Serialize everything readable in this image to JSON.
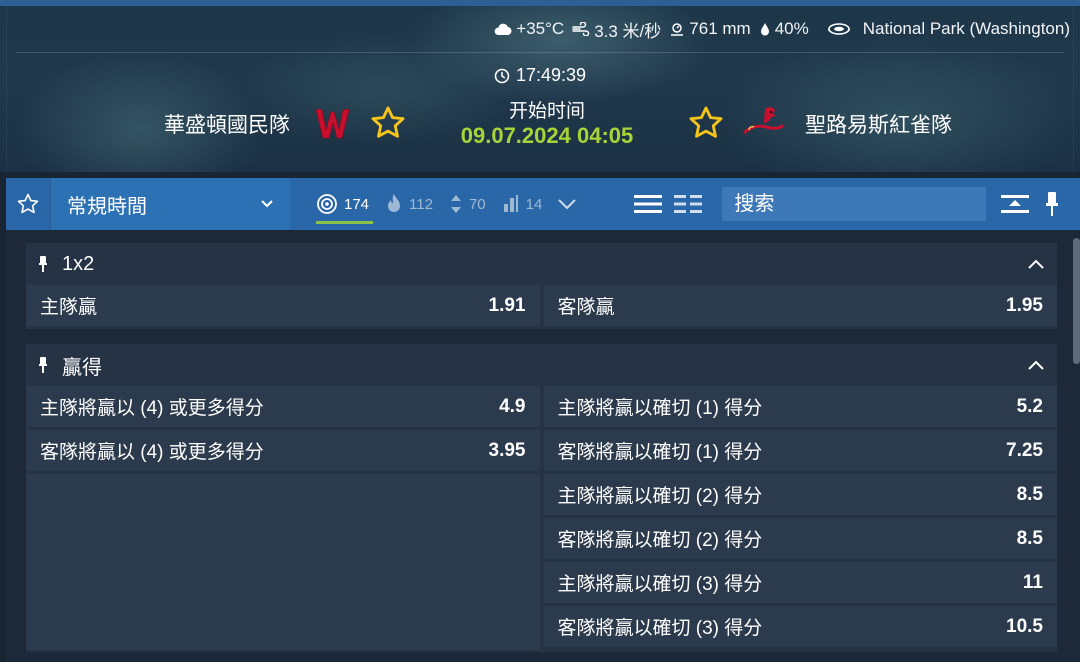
{
  "weather": {
    "temperature": "+35°C",
    "wind": "3.3 米/秒",
    "pressure": "761 mm",
    "humidity": "40%",
    "venue": "National Park (Washington)"
  },
  "event": {
    "clock": "17:49:39",
    "start_label": "开始时间",
    "start_datetime": "09.07.2024 04:05",
    "home_team": "華盛頓國民隊",
    "away_team": "聖路易斯紅雀隊"
  },
  "toolbar": {
    "period": "常規時間",
    "stats": [
      {
        "icon": "target-icon",
        "count": "174"
      },
      {
        "icon": "fire-icon",
        "count": "112"
      },
      {
        "icon": "updown-arrows-icon",
        "count": "70"
      },
      {
        "icon": "bar-chart-icon",
        "count": "14"
      }
    ],
    "search_placeholder": "搜索"
  },
  "colors": {
    "accent_green": "#a8d43a",
    "toolbar_blue": "#2a67a8",
    "star_yellow": "#f5c518"
  },
  "markets": [
    {
      "title": "1x2",
      "left": [
        {
          "label": "主隊贏",
          "value": "1.91"
        }
      ],
      "right": [
        {
          "label": "客隊贏",
          "value": "1.95"
        }
      ]
    },
    {
      "title": "贏得",
      "left": [
        {
          "label": "主隊將贏以 (4) 或更多得分",
          "value": "4.9"
        },
        {
          "label": "客隊將贏以 (4) 或更多得分",
          "value": "3.95"
        }
      ],
      "right": [
        {
          "label": "主隊將贏以確切 (1) 得分",
          "value": "5.2"
        },
        {
          "label": "客隊將贏以確切 (1) 得分",
          "value": "7.25"
        },
        {
          "label": "主隊將贏以確切 (2) 得分",
          "value": "8.5"
        },
        {
          "label": "客隊將贏以確切 (2) 得分",
          "value": "8.5"
        },
        {
          "label": "主隊將贏以確切 (3) 得分",
          "value": "11"
        },
        {
          "label": "客隊將贏以確切 (3) 得分",
          "value": "10.5"
        }
      ]
    }
  ]
}
